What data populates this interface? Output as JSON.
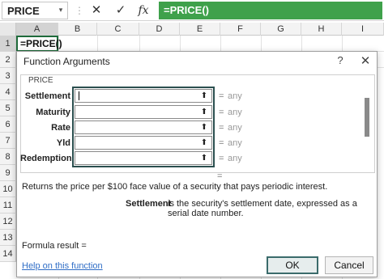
{
  "formula_bar": {
    "name_box": "PRICE",
    "name_box_dropdown": "▾",
    "dots": "⋮",
    "cancel_icon": "✕",
    "enter_icon": "✓",
    "fx_label": "fx",
    "formula": "=PRICE()"
  },
  "columns": [
    "A",
    "B",
    "C",
    "D",
    "E",
    "F",
    "G",
    "H",
    "I"
  ],
  "rows": [
    "1",
    "2",
    "3",
    "4",
    "5",
    "6",
    "7",
    "8",
    "9",
    "10",
    "11",
    "12",
    "13",
    "14"
  ],
  "cell_a1": "=PRICE()",
  "dialog": {
    "title": "Function Arguments",
    "help_icon": "?",
    "close_icon": "✕",
    "group_label": "PRICE",
    "args": [
      {
        "name": "Settlement",
        "result": "any"
      },
      {
        "name": "Maturity",
        "result": "any"
      },
      {
        "name": "Rate",
        "result": "any"
      },
      {
        "name": "Yld",
        "result": "any"
      },
      {
        "name": "Redemption",
        "result": "any"
      }
    ],
    "equals": "=",
    "collapse_icon": "⬆",
    "description": "Returns the price per $100 face value of a security that pays periodic interest.",
    "arg_help_name": "Settlement",
    "arg_help_text": "is the security's settlement date, expressed as a serial date number.",
    "formula_result_label": "Formula result =",
    "help_link": "Help on this function",
    "ok_label": "OK",
    "cancel_label": "Cancel"
  }
}
